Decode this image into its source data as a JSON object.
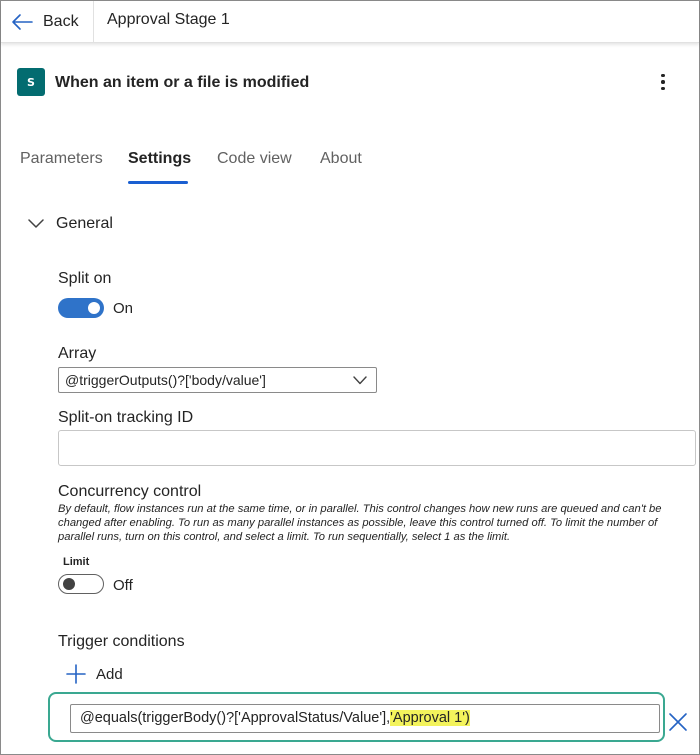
{
  "header": {
    "back_label": "Back",
    "title": "Approval Stage 1"
  },
  "trigger": {
    "icon": "sharepoint-icon",
    "icon_letter": "S",
    "title": "When an item or a file is modified"
  },
  "tabs": [
    {
      "label": "Parameters",
      "active": false
    },
    {
      "label": "Settings",
      "active": true
    },
    {
      "label": "Code view",
      "active": false
    },
    {
      "label": "About",
      "active": false
    }
  ],
  "section": {
    "title": "General",
    "split_on": {
      "label": "Split on",
      "state": "On",
      "enabled": true
    },
    "array": {
      "label": "Array",
      "value": "@triggerOutputs()?['body/value']"
    },
    "tracking_id": {
      "label": "Split-on tracking ID",
      "value": ""
    },
    "concurrency": {
      "label": "Concurrency control",
      "description": "By default, flow instances run at the same time, or in parallel. This control changes how new runs are queued and can't be changed after enabling. To run as many parallel instances as possible, leave this control turned off. To limit the number of parallel runs, turn on this control, and select a limit. To run sequentially, select 1 as the limit.",
      "limit_label": "Limit",
      "state": "Off",
      "enabled": false
    },
    "trigger_conditions": {
      "label": "Trigger conditions",
      "add_label": "Add",
      "condition_prefix": "@equals(triggerBody()?['ApprovalStatus/Value'],",
      "condition_highlight": "'Approval 1')"
    }
  },
  "colors": {
    "accent": "#1a5fd1",
    "toggle_on": "#2f73c9",
    "condition_border": "#3aa891",
    "highlight": "#f3f35c",
    "sharepoint": "#036c70"
  }
}
